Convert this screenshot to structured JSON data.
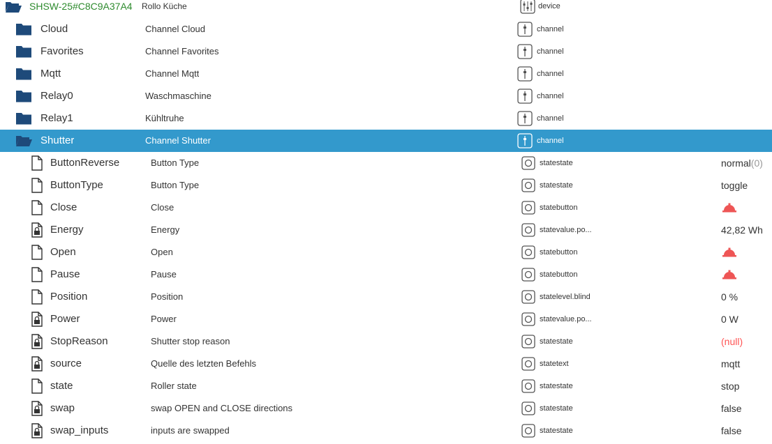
{
  "device_row": {
    "name": "SHSW-25#C8C9A37A4",
    "description": "Rollo Küche",
    "type": "device",
    "icon": "folder-open-icon"
  },
  "channels": [
    {
      "name": "Cloud",
      "description": "Channel Cloud",
      "type": "channel",
      "icon": "folder-icon"
    },
    {
      "name": "Favorites",
      "description": "Channel Favorites",
      "type": "channel",
      "icon": "folder-icon"
    },
    {
      "name": "Mqtt",
      "description": "Channel Mqtt",
      "type": "channel",
      "icon": "folder-icon"
    },
    {
      "name": "Relay0",
      "description": "Waschmaschine",
      "type": "channel",
      "icon": "folder-icon"
    },
    {
      "name": "Relay1",
      "description": "Kühltruhe",
      "type": "channel",
      "icon": "folder-icon"
    }
  ],
  "selected_channel": {
    "name": "Shutter",
    "description": "Channel Shutter",
    "type": "channel",
    "icon": "folder-open-icon",
    "highlight_color": "#3399cc"
  },
  "states": [
    {
      "name": "ButtonReverse",
      "description": "Button Type",
      "type": "statestate",
      "value": "normal",
      "value_suffix": "(0)",
      "readonly": false
    },
    {
      "name": "ButtonType",
      "description": "Button Type",
      "type": "statestate",
      "value": "toggle",
      "readonly": false
    },
    {
      "name": "Close",
      "description": "Close",
      "type": "statebutton",
      "value_icon": "bell-button-icon",
      "readonly": false
    },
    {
      "name": "Energy",
      "description": "Energy",
      "type": "statevalue.po...",
      "value": "42,82 Wh",
      "readonly": true
    },
    {
      "name": "Open",
      "description": "Open",
      "type": "statebutton",
      "value_icon": "bell-button-icon",
      "readonly": false
    },
    {
      "name": "Pause",
      "description": "Pause",
      "type": "statebutton",
      "value_icon": "bell-button-icon",
      "readonly": false
    },
    {
      "name": "Position",
      "description": "Position",
      "type": "statelevel.blind",
      "value": "0 %",
      "readonly": false
    },
    {
      "name": "Power",
      "description": "Power",
      "type": "statevalue.po...",
      "value": "0 W",
      "readonly": true
    },
    {
      "name": "StopReason",
      "description": "Shutter stop reason",
      "type": "statestate",
      "value": "(null)",
      "value_null": true,
      "readonly": true
    },
    {
      "name": "source",
      "description": "Quelle des letzten Befehls",
      "type": "statetext",
      "value": "mqtt",
      "readonly": true
    },
    {
      "name": "state",
      "description": "Roller state",
      "type": "statestate",
      "value": "stop",
      "readonly": false
    },
    {
      "name": "swap",
      "description": "swap OPEN and CLOSE directions",
      "type": "statestate",
      "value": "false",
      "readonly": true
    },
    {
      "name": "swap_inputs",
      "description": "inputs are swapped",
      "type": "statestate",
      "value": "false",
      "readonly": true
    }
  ],
  "colors": {
    "folder": "#1e4a7a",
    "selected_bg": "#3399cc",
    "device_name": "#2e8b2e",
    "button_icon": "#ee5555",
    "null_value": "#ff5555"
  }
}
